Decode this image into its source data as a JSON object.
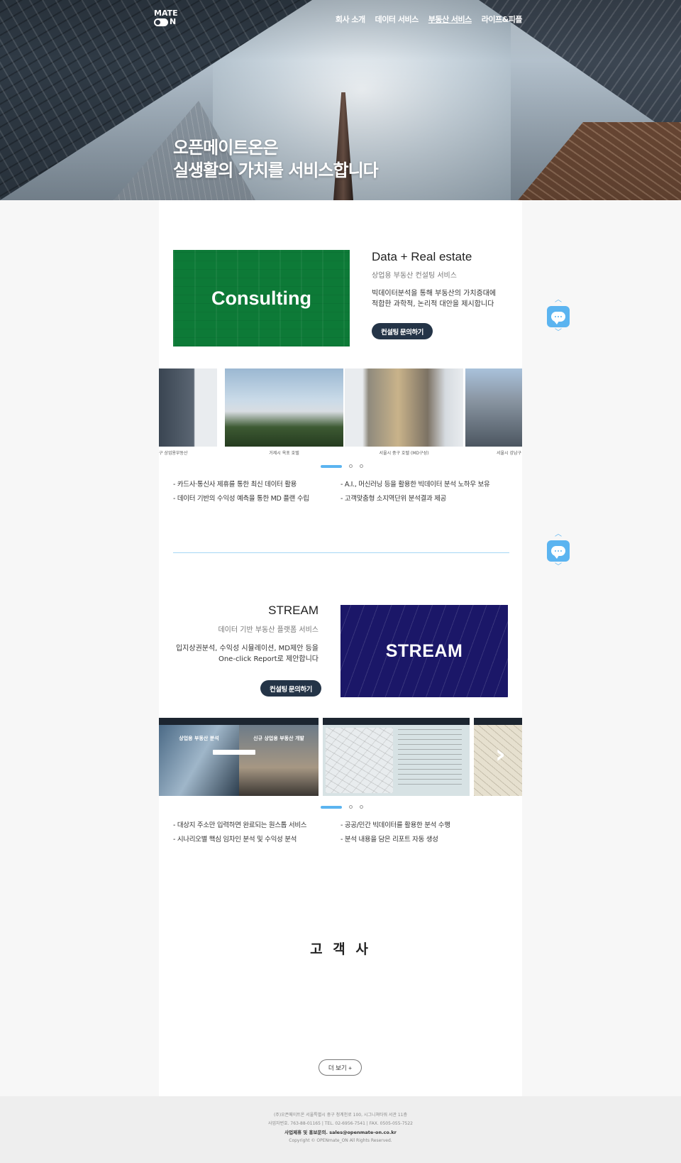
{
  "header": {
    "logo_top": "MATE",
    "logo_bottom": "N",
    "nav": [
      {
        "label": "회사 소개"
      },
      {
        "label": "데이터 서비스"
      },
      {
        "label": "부동산 서비스"
      },
      {
        "label": "라이프&피플"
      }
    ],
    "hero_line1": "오픈메이트온은",
    "hero_line2": "실생활의 가치를 서비스합니다"
  },
  "consulting": {
    "image_text": "Consulting",
    "title": "Data + Real estate",
    "subtitle": "상업용 부동산 컨설팅 서비스",
    "desc1": "빅데이터분석을 통해 부동산의 가치증대에",
    "desc2": "적합한 과학적, 논리적 대안을 제시합니다",
    "button": "컨설팅 문의하기",
    "slides": [
      {
        "caption": "구 상업용부동산"
      },
      {
        "caption": "거제시 옥포 호텔"
      },
      {
        "caption": "서울시 중구 호텔 (MD구성)"
      },
      {
        "caption": "서울시 강남구"
      }
    ],
    "bullets": [
      "- 카드사·통신사 제휴를 통한 최신 데이터 활용",
      "- A.I., 머신러닝 등을 활용한 빅데이터 분석 노하우 보유",
      "- 데이터 기반의 수익성 예측을 통한 MD 플랜 수립",
      "- 고객맞춤형 소지역단위 분석결과 제공"
    ]
  },
  "stream": {
    "image_text": "STREAM",
    "title": "STREAM",
    "subtitle": "데이터 기반 부동산 플랫폼 서비스",
    "desc1": "입지상권분석, 수익성 시뮬레이션, MD제안 등을",
    "desc2": "One-click Report로 제안합니다",
    "button": "컨설팅 문의하기",
    "shot1_left": "상업용 부동산 분석",
    "shot1_right": "신규 상업용 부동산 개발",
    "bullets": [
      "- 대상지 주소만 입력하면 완료되는 원스톱 서비스",
      "- 공공/민간 빅데이터를 활용한 분석 수행",
      "- 시나리오별 핵심 임차인 분석 및 수익성 분석",
      "- 분석 내용을 담은 리포트 자동 생성"
    ]
  },
  "clients": {
    "title": "고 객 사",
    "more": "더 보기 +"
  },
  "footer": {
    "line1": "(주)오픈메이트온 서울특별시 중구 청계천로 100, 시그니쳐타워 서관 11층",
    "line2": "사업자번호. 763-88-01165  |  TEL. 02-6956-7541  |  FAX. 0505-055-7522",
    "line3": "사업제휴 및 홍보문의. sales@openmate-on.co.kr",
    "line4": "Copyright © OPENmate_ON All Rights Reserved."
  }
}
